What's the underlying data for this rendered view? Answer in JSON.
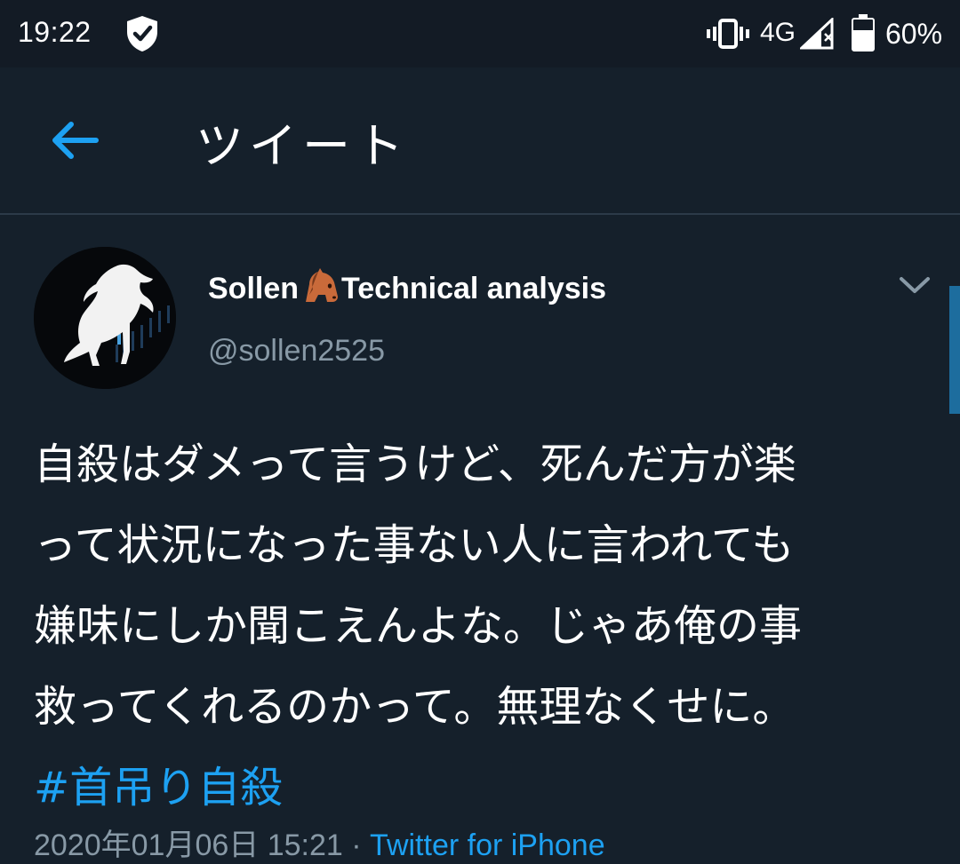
{
  "status_bar": {
    "time": "19:22",
    "network": "4G",
    "battery": "60%",
    "icons": [
      "shield-check-icon",
      "vibrate-icon",
      "signal-icon",
      "battery-icon"
    ]
  },
  "header": {
    "back_icon": "back-arrow-icon",
    "title": "ツイート"
  },
  "tweet": {
    "author_name_part1": "Sollen",
    "author_emoji": "horse-face-emoji",
    "author_name_part2": "Technical analysis",
    "handle": "@sollen2525",
    "menu_icon": "chevron-down-icon",
    "text_lines": [
      "自殺はダメって言うけど、死んだ方が楽",
      "って状況になった事ない人に言われても",
      "嫌味にしか聞こえんよな。じゃあ俺の事",
      "救ってくれるのかって。無理なくせに。"
    ],
    "hashtag": "#首吊り自殺",
    "timestamp": "2020年01月06日 15:21",
    "separator": "·",
    "source": "Twitter for iPhone"
  },
  "colors": {
    "background": "#15202b",
    "accent": "#1da1f2",
    "secondary_text": "#8899a6"
  }
}
